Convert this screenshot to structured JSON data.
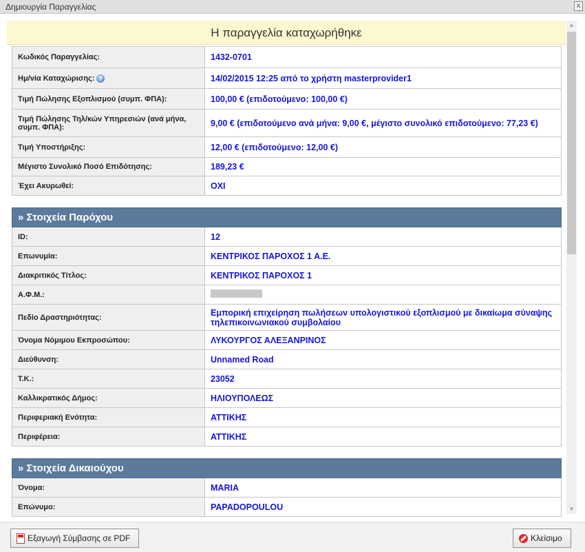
{
  "window": {
    "title": "Δημιουργία Παραγγελίας",
    "close": "x"
  },
  "banner": "Η παραγγελία καταχωρήθηκε",
  "order": [
    {
      "label": "Κωδικός Παραγγελίας:",
      "value": "1432-0701"
    },
    {
      "label": "Ημ/νία Καταχώρισης:",
      "value": "14/02/2015 12:25 από το χρήστη masterprovider1",
      "help": true
    },
    {
      "label": "Τιμή Πώλησης Εξοπλισμού (συμπ. ΦΠΑ):",
      "value": "100,00 € (επιδοτούμενο: 100,00 €)"
    },
    {
      "label": "Τιμή Πώλησης Τηλ/κών Υπηρεσιών (ανά μήνα, συμπ. ΦΠΑ):",
      "value": "9,00 € (επιδοτούμενο ανά μήνα: 9,00 €, μέγιστο συνολικό επιδοτούμενο: 77,23 €)"
    },
    {
      "label": "Τιμή Υποστήριξης:",
      "value": "12,00 € (επιδοτούμενο: 12,00 €)"
    },
    {
      "label": "Μέγιστο Συνολικό Ποσό Επιδότησης:",
      "value": "189,23 €"
    },
    {
      "label": "Έχει Ακυρωθεί:",
      "value": "ΟΧΙ"
    }
  ],
  "provider": {
    "title": "» Στοιχεία Παρόχου",
    "rows": [
      {
        "label": "ID:",
        "value": "12"
      },
      {
        "label": "Επωνυμία:",
        "value": "ΚΕΝΤΡΙΚΟΣ ΠΑΡΟΧΟΣ 1 Α.Ε."
      },
      {
        "label": "Διακριτικός Τίτλος:",
        "value": "ΚΕΝΤΡΙΚΟΣ ΠΑΡΟΧΟΣ 1"
      },
      {
        "label": "Α.Φ.Μ.:",
        "value": "",
        "redacted": true
      },
      {
        "label": "Πεδίο Δραστηριότητας:",
        "value": "Εμπορική επιχείρηση πωλήσεων υπολογιστικού εξοπλισμού με δικαίωμα σύναψης τηλεπικοινωνιακού συμβολαίου"
      },
      {
        "label": "Όνομα Νόμιμου Εκπροσώπου:",
        "value": "ΛΥΚΟΥΡΓΟΣ ΑΛΕΞΑΝΡΙΝΟΣ"
      },
      {
        "label": "Διεύθυνση:",
        "value": "Unnamed Road"
      },
      {
        "label": "Τ.Κ.:",
        "value": "23052"
      },
      {
        "label": "Καλλικρατικός Δήμος:",
        "value": "ΗΛΙΟΥΠΟΛΕΩΣ"
      },
      {
        "label": "Περιφεριακή Ενότητα:",
        "value": "ΑΤΤΙΚΗΣ"
      },
      {
        "label": "Περιφέρεια:",
        "value": "ΑΤΤΙΚΗΣ"
      }
    ]
  },
  "beneficiary": {
    "title": "» Στοιχεία Δικαιούχου",
    "rows": [
      {
        "label": "Όνομα:",
        "value": "MARIA"
      },
      {
        "label": "Επώνυμο:",
        "value": "PAPADOPOULOU"
      }
    ]
  },
  "footer": {
    "export_label": "Εξαγωγή Σύμβασης σε PDF",
    "close_label": "Κλείσιμο"
  }
}
